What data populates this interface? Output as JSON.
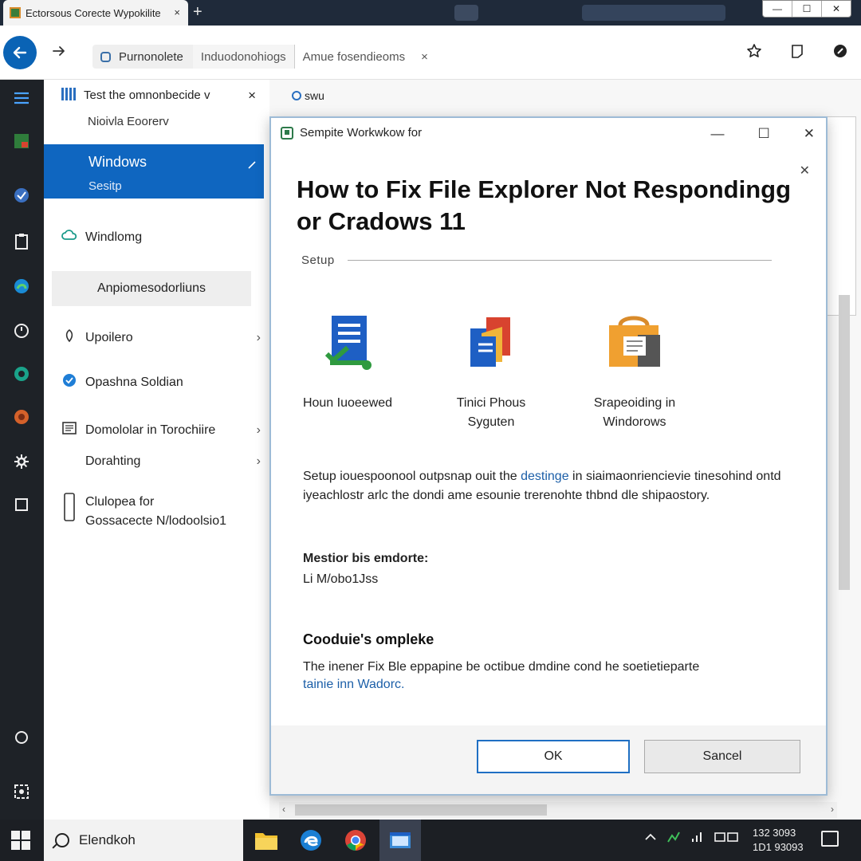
{
  "browser": {
    "tab_title": "Ectorsous Corecte Wypokilite",
    "tab_close": "×",
    "new_tab": "+",
    "window_controls": [
      "—",
      "☐",
      "✕"
    ]
  },
  "address_bar": {
    "segment1": "Purnonolete",
    "segment2": "Induodonohiogs",
    "segment3": "Amue fosendieoms",
    "close": "×"
  },
  "side_panel": {
    "header": "Test the omnonbecide",
    "header_caret": "v",
    "header_close": "×",
    "subheader": "Nioivla Eoorerv",
    "selected_item": {
      "title": "Windows",
      "subtitle": "Sesitp"
    },
    "items": [
      {
        "label": "Windlomg",
        "icon": "cloud-link-icon"
      },
      {
        "label": "Anpiomesodorliuns",
        "icon": ""
      },
      {
        "label": "Upoilero",
        "icon": "leaf-icon",
        "chevron": "›"
      },
      {
        "label": "Opashna Soldian",
        "icon": "circle-check-icon"
      },
      {
        "label": "Domololar in Torochiire",
        "icon": "document-icon",
        "chevron": "›"
      },
      {
        "label": "Dorahting",
        "icon": "",
        "chevron": "›"
      },
      {
        "label": "Clulopea for",
        "label2": "Gossacecte N/lodoolsio1",
        "icon": "phone-icon"
      }
    ]
  },
  "main_bg": {
    "label": "swu"
  },
  "dialog": {
    "title": "Sempite Workwkow for",
    "heading": "How to Fix File Explorer Not Respondingg or Cradows 11",
    "setup_label": "Setup",
    "options": [
      {
        "label": "Houn Iuoeewed",
        "icon": "document-check-icon"
      },
      {
        "label": "Tinici Phous Syguten",
        "icon": "copy-files-icon"
      },
      {
        "label": "Srapeoiding in Windorows",
        "icon": "package-icon"
      }
    ],
    "paragraph_pre": "Setup iouespoonool outpsnap ouit the ",
    "paragraph_link": "destinge",
    "paragraph_post": " in siaimaonriencievie tinesohind ontd iyeachlostr arlc the dondi ame esounie trerenohte thbnd dle shipaostory.",
    "status_label": "Mestior bis emdorte:",
    "status_value": "Li M/obo1Jss",
    "subheading": "Cooduie's ompleke",
    "sub_paragraph": "The inener Fix Ble eppapine be octibue dmdine cond he soetietieparte",
    "sub_link": "tainie inn Wadorc.",
    "ok_label": "OK",
    "cancel_label": "Sancel"
  },
  "taskbar": {
    "search_text": "Elendkoh",
    "clock_line1": "132 3093",
    "clock_line2": "1D1 93093",
    "tray_icons": [
      "chevron-up-icon",
      "network-icon",
      "signal-icon",
      "battery-icon"
    ]
  },
  "colors": {
    "accent": "#0f66c0",
    "rail": "#1e2227",
    "taskbar": "#1c1f24",
    "tabbar": "#1f2a3a"
  }
}
